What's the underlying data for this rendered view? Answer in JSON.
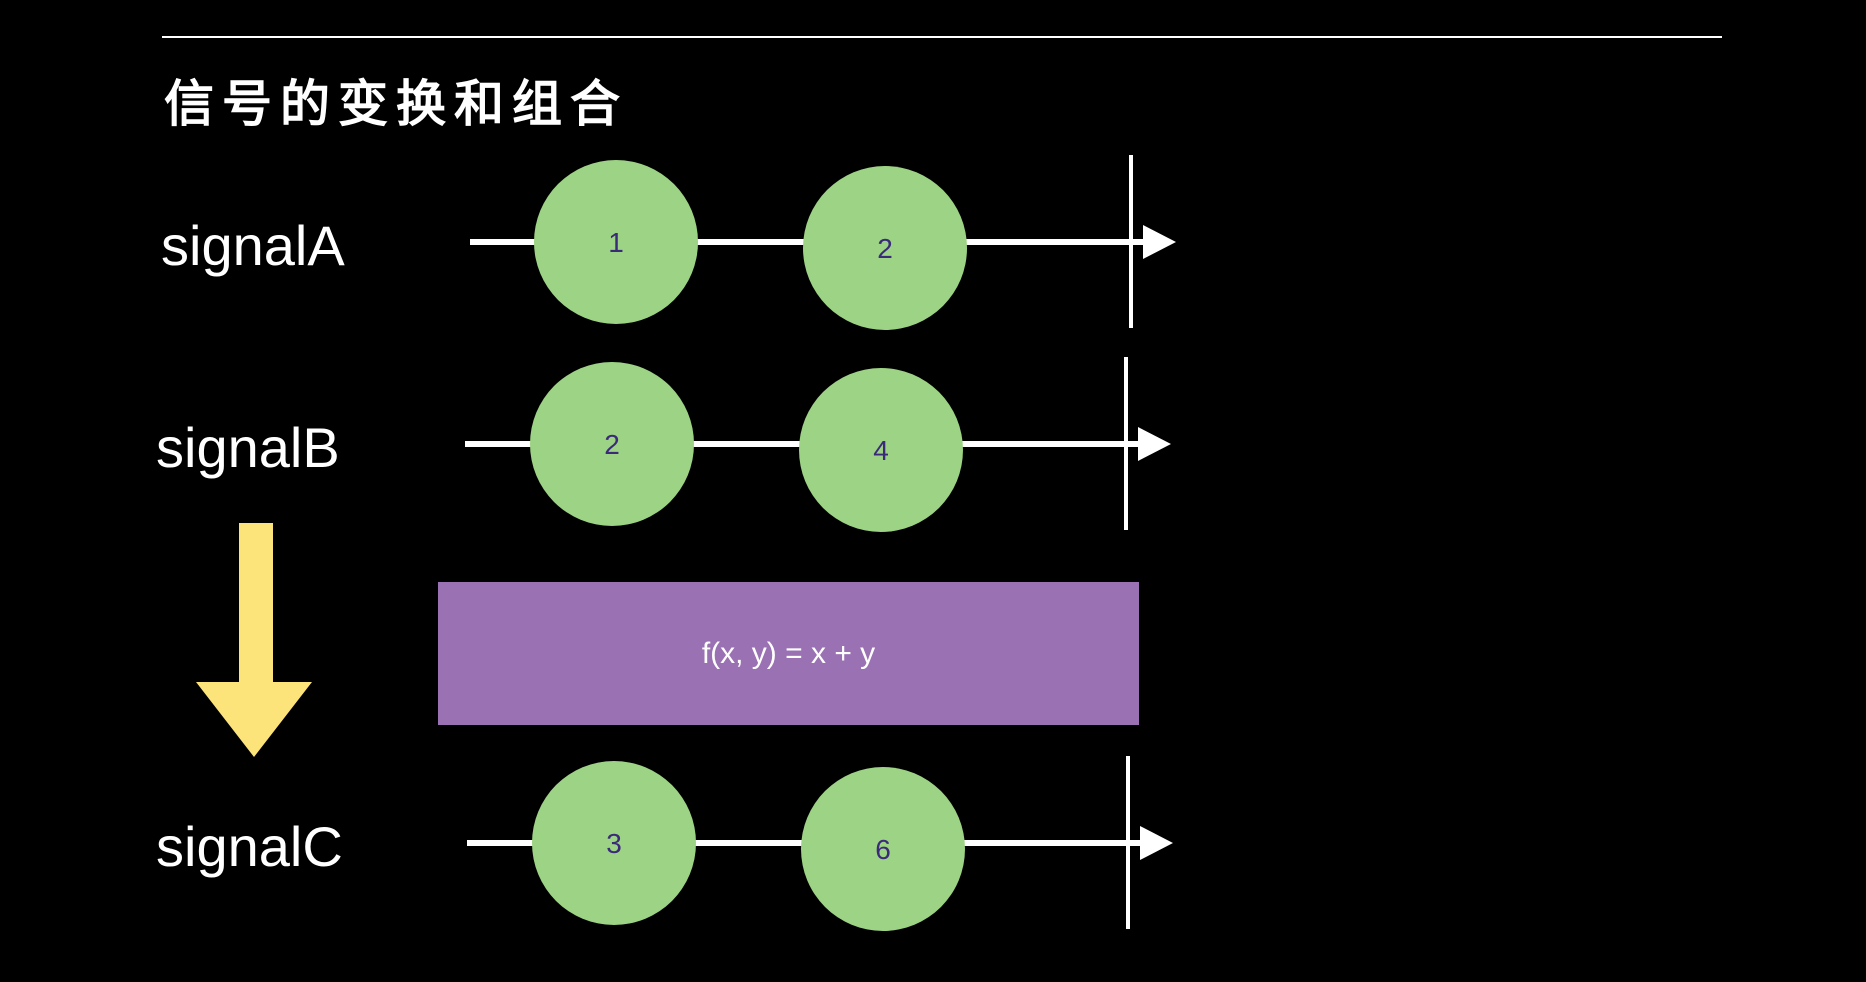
{
  "title": "信号的变换和组合",
  "colors": {
    "background": "#000000",
    "line": "#ffffff",
    "bubble": "#9dd384",
    "bubble_text": "#3b2a7a",
    "function_box": "#9a71b3",
    "arrow": "#fde47a"
  },
  "signals": [
    {
      "label": "signalA",
      "values": [
        "1",
        "2"
      ]
    },
    {
      "label": "signalB",
      "values": [
        "2",
        "4"
      ]
    },
    {
      "label": "signalC",
      "values": [
        "3",
        "6"
      ]
    }
  ],
  "function": {
    "label": "f(x, y) = x + y"
  }
}
